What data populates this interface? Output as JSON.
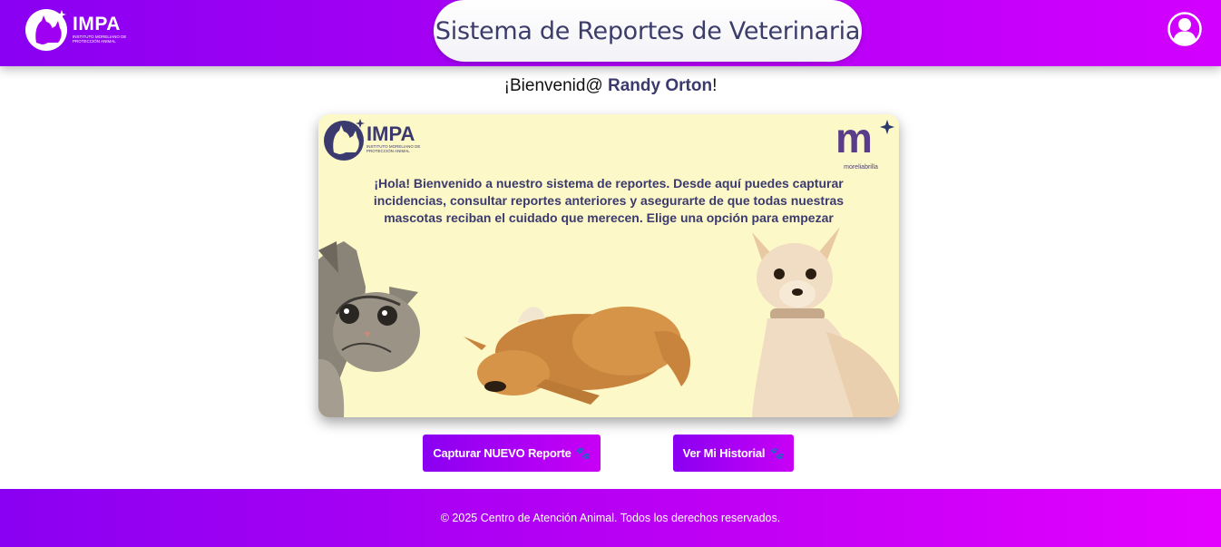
{
  "header": {
    "logo": {
      "name": "IMPA",
      "subtitle": "Instituto Moreliano de Protección Animal"
    },
    "title": "Sistema de Reportes de Veterinaria",
    "user_icon": "user-avatar-icon"
  },
  "welcome": {
    "greeting": "¡Bienvenid@ ",
    "user_name": "Randy Orton",
    "suffix": "!"
  },
  "banner": {
    "logo_name": "IMPA",
    "logo_subtitle": "Instituto Moreliano de Protección Animal",
    "partner_letter": "m",
    "partner_name": "moreliabrilla",
    "message": "¡Hola! Bienvenido a nuestro sistema de reportes. Desde aquí puedes capturar incidencias, consultar reportes anteriores y asegurarte de que todas nuestras mascotas reciban el cuidado que merecen. Elige una opción para empezar"
  },
  "actions": {
    "new_report_label": "Capturar NUEVO Reporte",
    "history_label": "Ver Mi Historial",
    "paw_glyph": "🐾"
  },
  "footer": {
    "text": "© 2025 Centro de Atención Animal. Todos los derechos reservados."
  },
  "colors": {
    "primary": "#8a00f2",
    "accent": "#d300ff",
    "text_dark": "#3b3a6e",
    "banner_bg": "#fdf8c8"
  }
}
